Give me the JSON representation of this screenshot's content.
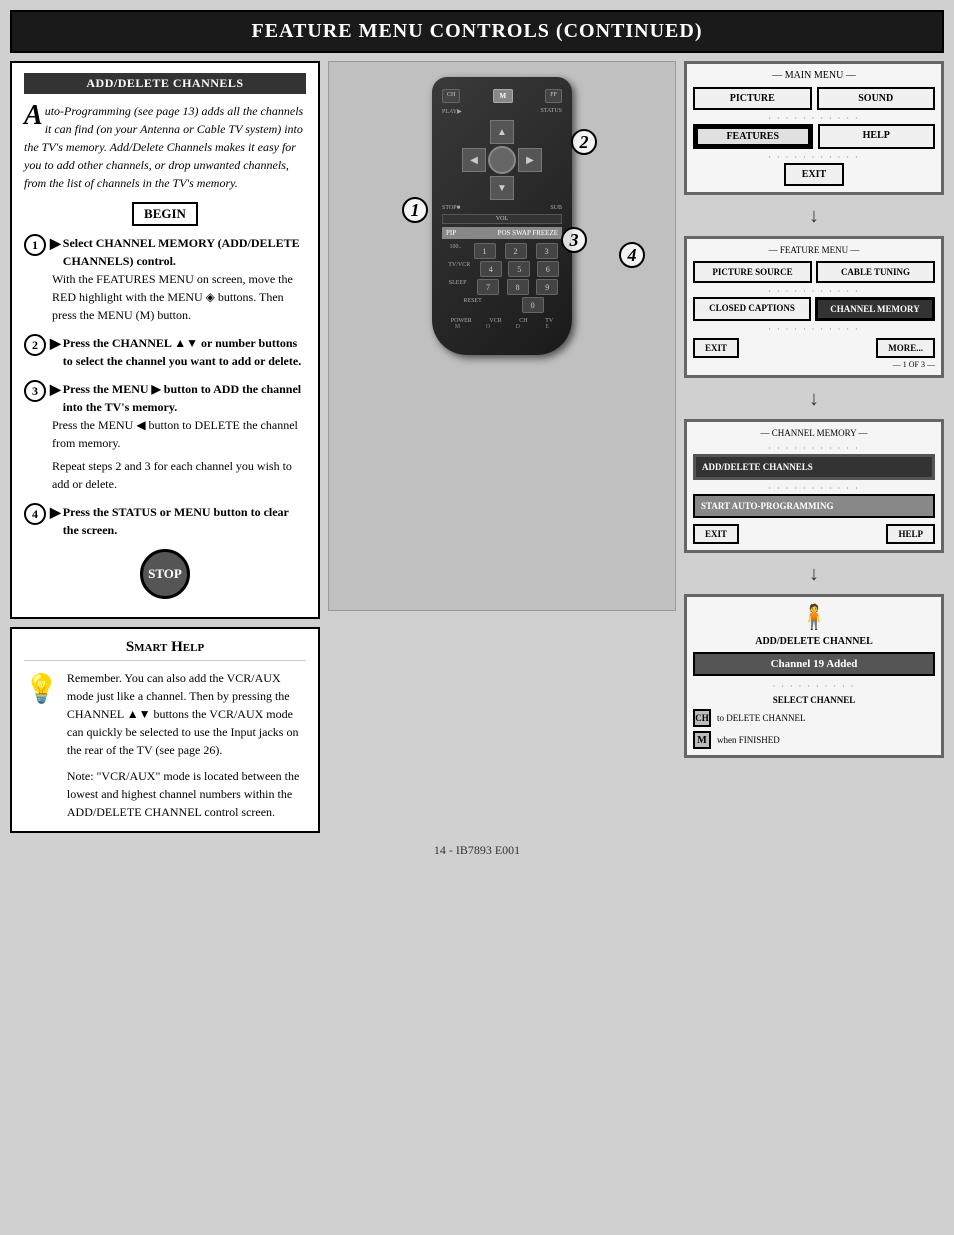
{
  "page": {
    "title": "Feature Menu Controls (Continued)",
    "footer": "14 - IB7893 E001"
  },
  "header": {
    "label": "Feature Menu Controls (Continued)"
  },
  "instructions": {
    "section_title": "ADD/DELETE CHANNELS",
    "intro": "uto-Programming (see page 13) adds all the channels it can find (on your Antenna or Cable TV system) into the TV's memory. Add/Delete Channels makes it easy for you to add other channels, or drop unwanted channels, from the list of channels in the TV's memory.",
    "begin_label": "BEGIN",
    "steps": [
      {
        "num": "1",
        "bold": "Select CHANNEL MEMORY (ADD/DELETE CHANNELS) control.",
        "body": "With the FEATURES MENU on screen, move the RED highlight with the MENU ◈ buttons. Then press the MENU (M) button."
      },
      {
        "num": "2",
        "bold": "Press the CHANNEL ▲▼ or number buttons to select the channel you want to add or delete."
      },
      {
        "num": "3",
        "bold": "Press the MENU ▶ button to ADD the channel into the TV's memory.",
        "body1": "Press the MENU ◀ button to DELETE the channel from memory.",
        "body2": "Repeat steps 2 and 3 for each channel you wish to add or delete."
      },
      {
        "num": "4",
        "bold": "Press the STATUS or MENU button to clear the screen."
      }
    ],
    "stop_label": "STOP"
  },
  "smart_help": {
    "title": "Smart Help",
    "content": "Remember. You can also add the VCR/AUX mode just like a channel. Then by pressing the CHANNEL ▲▼ buttons the VCR/AUX mode can quickly be selected to use the Input jacks on the rear of the TV (see page 26).",
    "note": "Note: \"VCR/AUX\" mode is located between the lowest and highest channel numbers within the ADD/DELETE CHANNEL control screen."
  },
  "main_menu_screen": {
    "title": "— MAIN MENU —",
    "buttons": [
      "PICTURE",
      "SOUND",
      "FEATURES",
      "HELP",
      "EXIT"
    ],
    "features_highlighted": true
  },
  "feature_menu_screen": {
    "title": "— FEATURE MENU —",
    "buttons": [
      "PICTURE SOURCE",
      "CABLE TUNING",
      "CLOSED CAPTIONS",
      "CHANNEL MEMORY",
      "EXIT",
      "MORE..."
    ],
    "page_indicator": "— 1 OF 3 —",
    "channel_memory_highlighted": true
  },
  "channel_memory_screen": {
    "title": "— CHANNEL MEMORY —",
    "options": [
      "ADD/DELETE CHANNELS",
      "START AUTO-PROGRAMMING"
    ],
    "buttons": [
      "EXIT",
      "HELP"
    ],
    "add_delete_highlighted": true
  },
  "add_delete_result_screen": {
    "title": "ADD/DELETE CHANNEL",
    "badge": "Channel 19 Added",
    "lines": [
      {
        "icon": "SELECT CHANNEL",
        "text": ""
      },
      {
        "icon": "CH",
        "text": "to DELETE CHANNEL"
      },
      {
        "icon": "M",
        "text": "when FINISHED"
      }
    ]
  },
  "remote": {
    "labels": [
      "1",
      "2",
      "3",
      "4"
    ],
    "buttons": {
      "play": "PLAY▶",
      "status": "STATUS",
      "stop": "STOP",
      "sub": "SUB",
      "m": "M",
      "pip": "PIP",
      "pos": "POS",
      "swap": "SWAP",
      "freeze": "FREEZE",
      "power": "POWER",
      "vcr": "VCR",
      "ch": "CH",
      "tv": "TV",
      "vol": "VOL",
      "sleep": "SLEEP",
      "reset": "RESET"
    }
  }
}
